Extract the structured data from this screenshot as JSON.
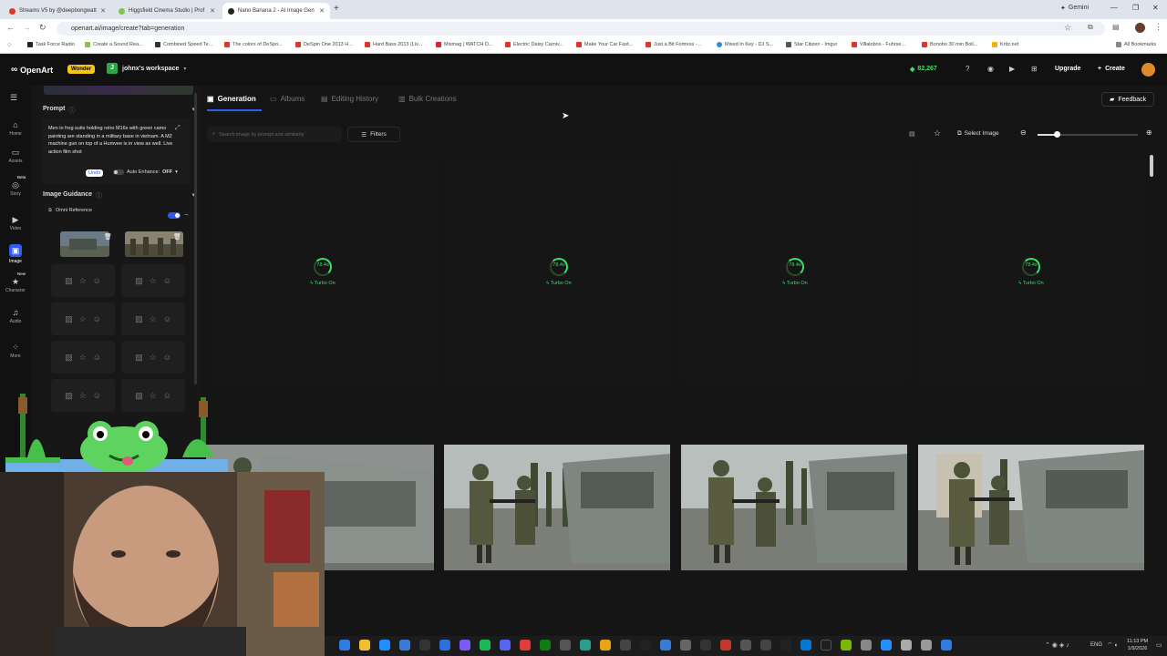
{
  "browser": {
    "tabs": [
      {
        "title": "Streams V5 by @deepbongwatt",
        "color": "#e0342c"
      },
      {
        "title": "Higgsfield Cinema Studio | Prof",
        "color": "#7ac94a"
      },
      {
        "title": "Nano Banana 2 - AI Image Gen",
        "color": "#222222"
      }
    ],
    "new_tab": "+",
    "gemini_label": "Gemini",
    "url": "openart.ai/image/create?tab=generation",
    "bookmarks": [
      "Task Force Radio",
      "Create a Sound Rea...",
      "Combined Speed Te...",
      "The colors of DeSpo...",
      "DeSpin One 2013 H...",
      "Hard Bass 2013 (Liv...",
      "Mismag | WATCH D...",
      "Electric Daisy Carniv...",
      "Make Your Car Fast...",
      "Just a Bit Fortress -...",
      "Mixed In Key - DJ S...",
      "Star Citizen - Imgur",
      "Villalobos - Fuhrse...",
      "Bonobo 30 min Boil...",
      "Kritz.net"
    ],
    "all_bookmarks": "All Bookmarks"
  },
  "header": {
    "logo": "OpenArt",
    "badge": "Wonder",
    "workspace_initial": "J",
    "workspace": "johnx's workspace",
    "credits": "82,267",
    "upgrade": "Upgrade",
    "create": "Create"
  },
  "rail": [
    {
      "label": "Home",
      "icon": "home-icon",
      "glyph": "⌂"
    },
    {
      "label": "Assets",
      "icon": "folder-icon",
      "glyph": "▭"
    },
    {
      "label": "Story",
      "icon": "story-icon",
      "glyph": "◎",
      "badge": "Beta"
    },
    {
      "label": "Video",
      "icon": "video-icon",
      "glyph": "▶"
    },
    {
      "label": "Image",
      "icon": "image-icon",
      "glyph": "▣",
      "active": true
    },
    {
      "label": "Character",
      "icon": "character-icon",
      "glyph": "★",
      "badge": "New"
    },
    {
      "label": "Audio",
      "icon": "audio-icon",
      "glyph": "♫"
    },
    {
      "label": "More",
      "icon": "grid-icon",
      "glyph": "⁘"
    }
  ],
  "panel": {
    "prompt_label": "Prompt",
    "prompt_text": "Men in frog suits holding retro M16s with green camo painting are standing in a military base in vietnam. A M2 machine gun on top of a Humvee is in view as well. Live action film shot",
    "undo": "Undo",
    "auto_enhance": "Auto Enhance:",
    "auto_enhance_state": "OFF",
    "image_guidance": "Image Guidance",
    "omni_reference": "Omni Reference"
  },
  "main": {
    "tabs": [
      "Generation",
      "Albums",
      "Editing History",
      "Bulk Creations"
    ],
    "feedback": "Feedback",
    "search_placeholder": "Search image by prompt and similarity",
    "filters": "Filters",
    "select_image": "Select Image",
    "zoom_fraction": 0.19,
    "pending": [
      {
        "time": "78.4s",
        "mode": "Turbo On"
      },
      {
        "time": "78.4s",
        "mode": "Turbo On"
      },
      {
        "time": "78.4s",
        "mode": "Turbo On"
      },
      {
        "time": "78.4s",
        "mode": "Turbo On"
      }
    ]
  },
  "taskbar": {
    "lang": "ENG",
    "time": "11:13 PM",
    "date": "1/9/2026"
  }
}
